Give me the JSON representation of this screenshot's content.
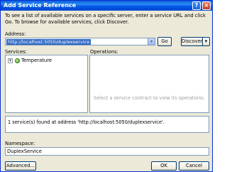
{
  "window": {
    "title": "Add Service Reference",
    "help_glyph": "?",
    "close_glyph": "×"
  },
  "intro_text": "To see a list of available services on a specific server, enter a service URL and click Go. To browse for available services, click Discover.",
  "address": {
    "label": "Address:",
    "value": "http://localhost:5050/duplexservice",
    "dropdown_glyph": "▾",
    "go_label": "Go",
    "discover_label": "Discover",
    "discover_drop_glyph": "▾"
  },
  "services": {
    "label": "Services:",
    "items": [
      {
        "expander": "+",
        "label": "Temperature"
      }
    ]
  },
  "operations": {
    "label": "Operations:",
    "hint": "Select a service contract to view its operations."
  },
  "status_text": "1 service(s) found at address 'http://localhost:5050/duplexservice'.",
  "namespace": {
    "label": "Namespace:",
    "value": "DuplexService"
  },
  "buttons": {
    "advanced_label": "Advanced...",
    "ok_label": "OK",
    "cancel_label": "Cancel"
  },
  "colors": {
    "titlebar": "#0055e5",
    "dialog_bg": "#ece9d8",
    "selection": "#316ac5",
    "field_border": "#7f9db9"
  }
}
